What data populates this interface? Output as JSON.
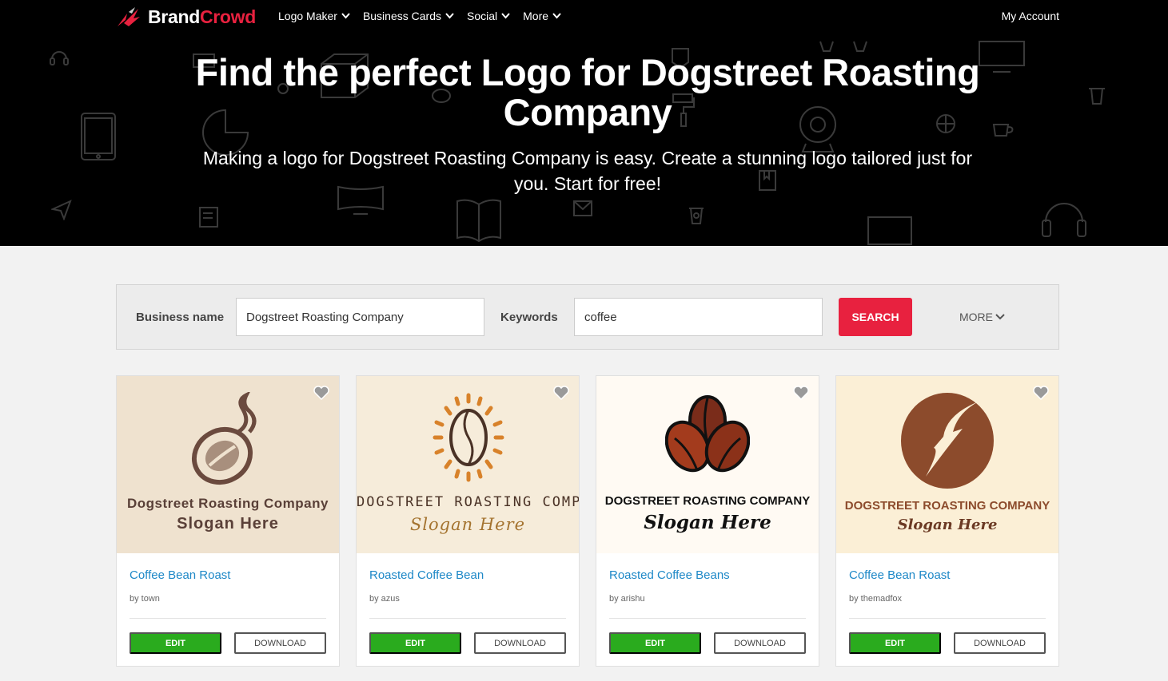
{
  "brand": {
    "part1": "Brand",
    "part2": "Crowd"
  },
  "nav": {
    "items": [
      {
        "label": "Logo Maker"
      },
      {
        "label": "Business Cards"
      },
      {
        "label": "Social"
      },
      {
        "label": "More"
      }
    ],
    "account": "My Account"
  },
  "hero": {
    "title": "Find the perfect Logo for Dogstreet Roasting Company",
    "subtitle": "Making a logo for Dogstreet Roasting Company is easy. Create a stunning logo tailored just for you. Start for free!"
  },
  "search": {
    "business_label": "Business name",
    "business_value": "Dogstreet Roasting Company",
    "keywords_label": "Keywords",
    "keywords_value": "coffee",
    "search_label": "SEARCH",
    "more_label": "MORE"
  },
  "colors": {
    "accent": "#e8213f",
    "edit": "#2aab1e",
    "link": "#1e88c7"
  },
  "cards": [
    {
      "title": "Coffee Bean Roast",
      "author": "by town",
      "logo_name": "Dogstreet Roasting Company",
      "logo_slogan": "Slogan Here",
      "edit": "EDIT",
      "download": "DOWNLOAD"
    },
    {
      "title": "Roasted Coffee Bean",
      "author": "by azus",
      "logo_name": "DOGSTREET ROASTING COMPANY",
      "logo_slogan": "Slogan Here",
      "edit": "EDIT",
      "download": "DOWNLOAD"
    },
    {
      "title": "Roasted Coffee Beans",
      "author": "by arishu",
      "logo_name": "DOGSTREET ROASTING COMPANY",
      "logo_slogan": "Slogan Here",
      "edit": "EDIT",
      "download": "DOWNLOAD"
    },
    {
      "title": "Coffee Bean Roast",
      "author": "by themadfox",
      "logo_name": "DOGSTREET ROASTING COMPANY",
      "logo_slogan": "Slogan Here",
      "edit": "EDIT",
      "download": "DOWNLOAD"
    }
  ]
}
